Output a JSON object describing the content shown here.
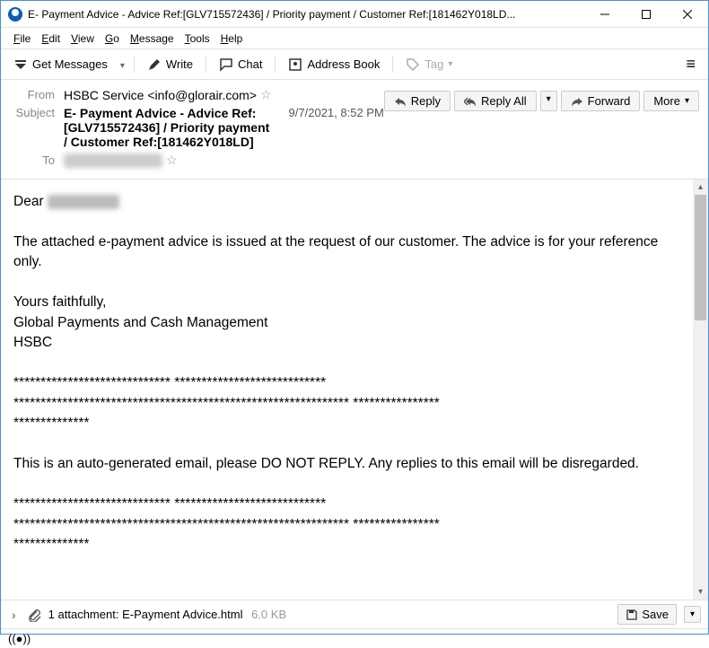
{
  "window": {
    "title": "E- Payment Advice - Advice Ref:[GLV715572436] / Priority payment / Customer Ref:[181462Y018LD..."
  },
  "menu": {
    "file": "File",
    "edit": "Edit",
    "view": "View",
    "go": "Go",
    "message": "Message",
    "tools": "Tools",
    "help": "Help"
  },
  "toolbar": {
    "get_messages": "Get Messages",
    "write": "Write",
    "chat": "Chat",
    "address_book": "Address Book",
    "tag": "Tag"
  },
  "actions": {
    "reply": "Reply",
    "reply_all": "Reply All",
    "forward": "Forward",
    "more": "More"
  },
  "headers": {
    "from_label": "From",
    "from_value": "HSBC Service <info@glorair.com>",
    "subject_label": "Subject",
    "subject_value": "E- Payment Advice - Advice Ref:[GLV715572436] / Priority payment / Customer Ref:[181462Y018LD]",
    "date": "9/7/2021, 8:52 PM",
    "to_label": "To"
  },
  "body": {
    "greeting": "Dear",
    "p1": "The attached e-payment advice is issued at the request of our customer. The advice is for your reference only.",
    "p2a": "Yours faithfully,",
    "p2b": "Global Payments and Cash Management",
    "p2c": "HSBC",
    "sep1": "***************************** ****************************",
    "sep2": "************************************************************** ****************",
    "sep3": "**************",
    "p3": "This is an auto-generated email, please DO NOT REPLY. Any replies to this email will be disregarded.",
    "sep4": "***************************** ****************************",
    "sep5": "************************************************************** ****************",
    "sep6": "**************"
  },
  "attachment": {
    "count_label": "1 attachment:",
    "filename": "E-Payment Advice.html",
    "size": "6.0 KB",
    "save": "Save"
  }
}
